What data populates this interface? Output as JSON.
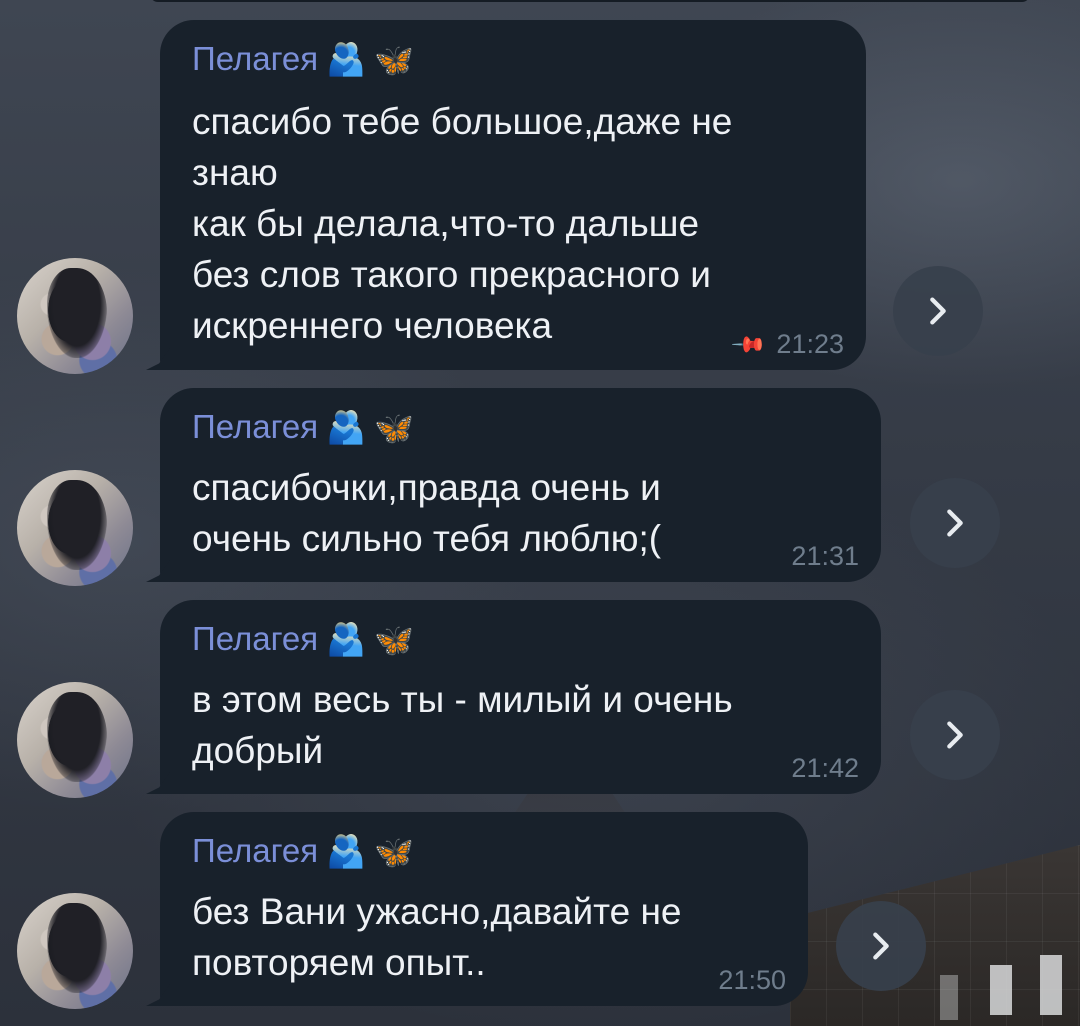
{
  "messages": [
    {
      "sender": "Пелагея",
      "sender_emoji": "🫂",
      "sender_emoji2": "🦋",
      "text": "спасибо тебе большое,даже не\nзнаю\nкак бы делала,что-то дальше\nбез слов такого прекрасного и\nискреннего человека",
      "time": "21:23",
      "pinned": true,
      "forward_icon": "chevron-right-icon"
    },
    {
      "sender": "Пелагея",
      "sender_emoji": "🫂",
      "sender_emoji2": "🦋",
      "text": "спасибочки,правда очень и\nочень сильно тебя люблю;(",
      "time": "21:31",
      "pinned": false,
      "forward_icon": "chevron-right-icon"
    },
    {
      "sender": "Пелагея",
      "sender_emoji": "🫂",
      "sender_emoji2": "🦋",
      "text": "в этом весь ты - милый и очень\nдобрый",
      "time": "21:42",
      "pinned": false,
      "forward_icon": "chevron-right-icon"
    },
    {
      "sender": "Пелагея",
      "sender_emoji": "🫂",
      "sender_emoji2": "🦋",
      "text": "без Вани ужасно,давайте не\nповторяем опыт..",
      "time": "21:50",
      "pinned": false,
      "forward_icon": "chevron-right-icon"
    }
  ],
  "colors": {
    "bubble": "#18212b",
    "sender_name": "#7b8fd8",
    "message_text": "#eef1f5",
    "timestamp": "#6f7d8c"
  }
}
